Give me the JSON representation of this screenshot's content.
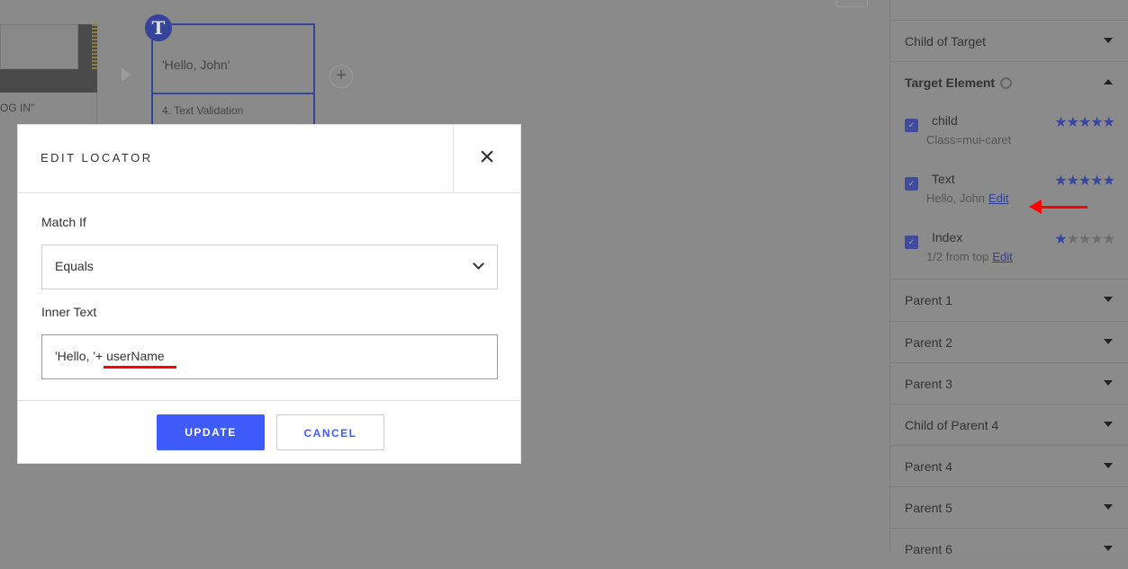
{
  "canvas": {
    "prev_step_caption": "OG IN\"",
    "step_value": "'Hello, John'",
    "step_label": "4. Text Validation",
    "step_badge": "T",
    "add_label": "+"
  },
  "side_panel": {
    "child_of_target": "Child of Target",
    "target_element": "Target Element",
    "items": [
      {
        "name": "child",
        "sub": "Class=mui-caret",
        "edit": "",
        "rating": 5
      },
      {
        "name": "Text",
        "sub": "Hello, John",
        "edit": "Edit",
        "rating": 5
      },
      {
        "name": "Index",
        "sub": "1/2 from top",
        "edit": "Edit",
        "rating": 1
      }
    ],
    "sections": [
      "Parent 1",
      "Parent 2",
      "Parent 3",
      "Child of Parent 4",
      "Parent 4",
      "Parent 5",
      "Parent 6"
    ]
  },
  "modal": {
    "title": "EDIT LOCATOR",
    "close": "×",
    "match_if_label": "Match If",
    "match_if_value": "Equals",
    "inner_text_label": "Inner Text",
    "inner_text_value": "'Hello, '+ userName",
    "update": "UPDATE",
    "cancel": "CANCEL"
  },
  "colors": {
    "accent": "#3f5bfb",
    "step_border": "#35449a",
    "annotation": "#ff0000"
  }
}
